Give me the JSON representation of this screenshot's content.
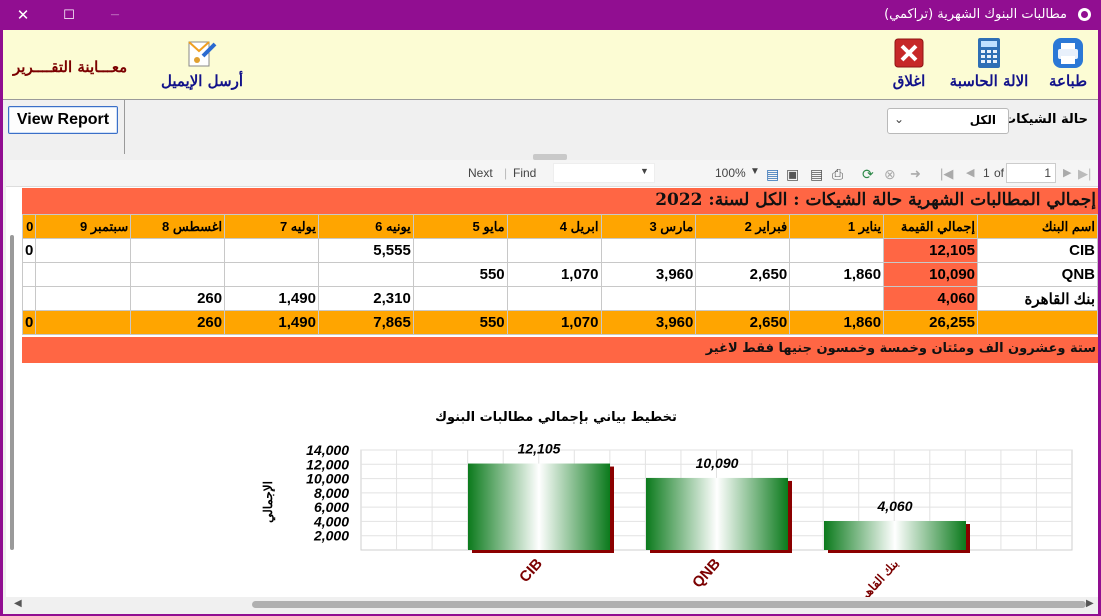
{
  "window": {
    "title": "مطالبات البنوك الشهرية (تراكمي)",
    "controls": {
      "close": "✕",
      "maximize": "☐",
      "minimize": "—"
    }
  },
  "toolbar": {
    "print_label": "طباعة",
    "calculator_label": "الالة الحاسبة",
    "close_label": "اغلاق",
    "email_label": "أرسل الإيميل",
    "preview_title": "معـــاينة التقــــرير"
  },
  "params": {
    "view_report_label": "View Report",
    "status_label": "حالة الشيكات",
    "status_value": "الكل"
  },
  "navbar": {
    "page_current": "1",
    "page_of": "of",
    "page_total": "1",
    "zoom": "100%",
    "find_label": "Find",
    "next_label": "Next"
  },
  "report": {
    "title": "إجمالي المطالبات الشهرية حالة الشيكات : الكل  لسنة: 2022",
    "headers": [
      "اسم البنك",
      "إجمالي القيمة",
      "1 يناير",
      "2 فبراير",
      "3 مارس",
      "4 ابريل",
      "5 مايو",
      "6 يونيه",
      "7 يوليه",
      "8 اغسطس",
      "9 سبتمبر",
      "0"
    ],
    "rows": [
      {
        "bank": "CIB",
        "cells": [
          "12,105",
          "",
          "",
          "",
          "",
          "",
          "5,555",
          "",
          "",
          "",
          "0"
        ]
      },
      {
        "bank": "QNB",
        "cells": [
          "10,090",
          "1,860",
          "2,650",
          "3,960",
          "1,070",
          "550",
          "",
          "",
          "",
          "",
          ""
        ]
      },
      {
        "bank": "بنك القاهرة",
        "cells": [
          "4,060",
          "",
          "",
          "",
          "",
          "",
          "2,310",
          "1,490",
          "260",
          "",
          ""
        ]
      }
    ],
    "totals": [
      "26,255",
      "1,860",
      "2,650",
      "3,960",
      "1,070",
      "550",
      "7,865",
      "1,490",
      "260",
      "",
      "0"
    ],
    "amount_in_words": "ستة وعشرون الف ومئتان وخمسة وخمسون جنيها فقط لاغير"
  },
  "chart_data": {
    "type": "bar",
    "title": "تخطيط بياني بإجمالي مطالبات البنوك",
    "ylabel": "الإجمالي",
    "xlabel": "",
    "categories": [
      "CIB",
      "QNB",
      "بنك القاهرة"
    ],
    "values": [
      12105,
      10090,
      4060
    ],
    "data_labels": [
      "12,105",
      "10,090",
      "4,060"
    ],
    "ylim": [
      0,
      14000
    ],
    "yticks": [
      "2,000",
      "4,000",
      "6,000",
      "8,000",
      "10,000",
      "12,000",
      "14,000"
    ],
    "grid": true,
    "colors": {
      "bar_dark": "#0b7a1c",
      "bar_light": "#ffffff",
      "shadow": "#8b0000",
      "label": "#7b0000"
    }
  }
}
